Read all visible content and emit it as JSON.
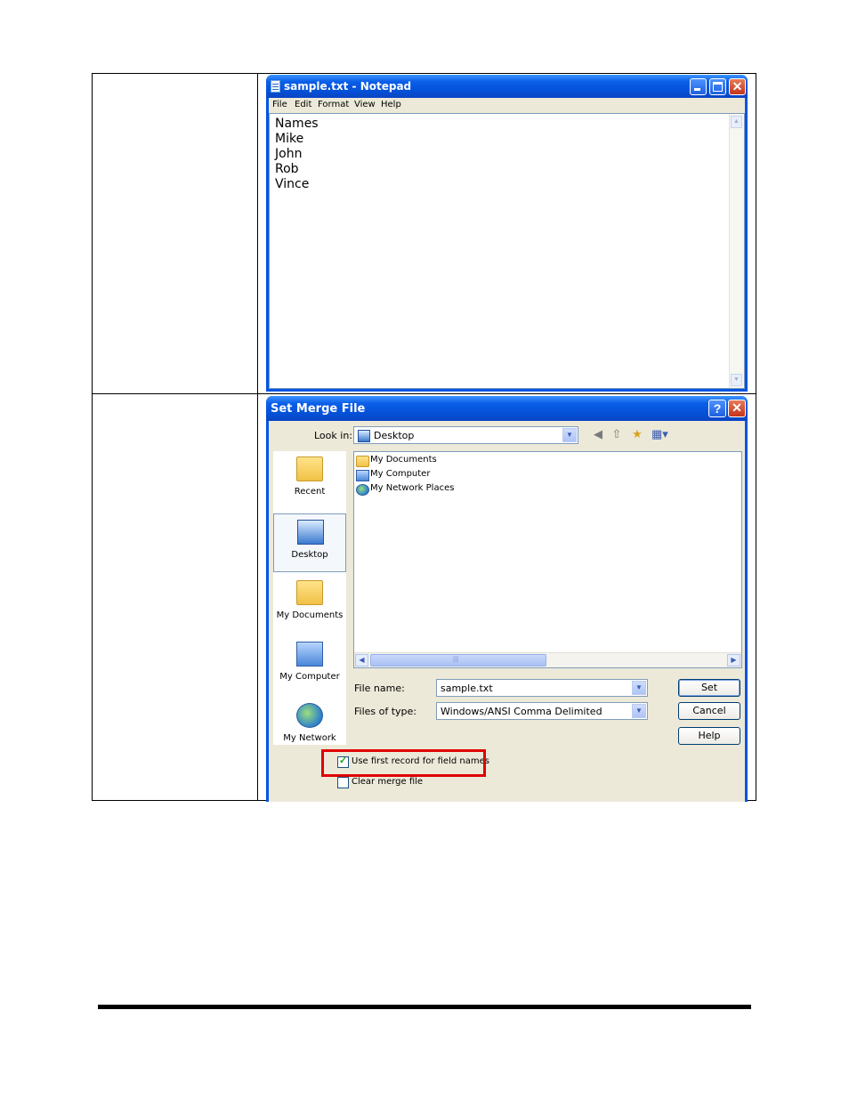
{
  "notepad": {
    "title": "sample.txt - Notepad",
    "menu": [
      "File",
      "Edit",
      "Format",
      "View",
      "Help"
    ],
    "lines": [
      "Names",
      "Mike",
      "John",
      "Rob",
      "Vince"
    ]
  },
  "dialog": {
    "title": "Set Merge File",
    "look_in_label": "Look in:",
    "look_in_value": "Desktop",
    "places": [
      "Recent",
      "Desktop",
      "My Documents",
      "My Computer",
      "My Network"
    ],
    "files": [
      "My Documents",
      "My Computer",
      "My Network Places"
    ],
    "file_name_label": "File name:",
    "file_name_value": "sample.txt",
    "files_of_type_label": "Files of type:",
    "files_of_type_value": "Windows/ANSI Comma Delimited",
    "buttons": {
      "set": "Set",
      "cancel": "Cancel",
      "help": "Help"
    },
    "use_first_record": {
      "label": "Use first record for field names",
      "checked": true
    },
    "clear_merge": {
      "label": "Clear merge file",
      "checked": false
    }
  }
}
